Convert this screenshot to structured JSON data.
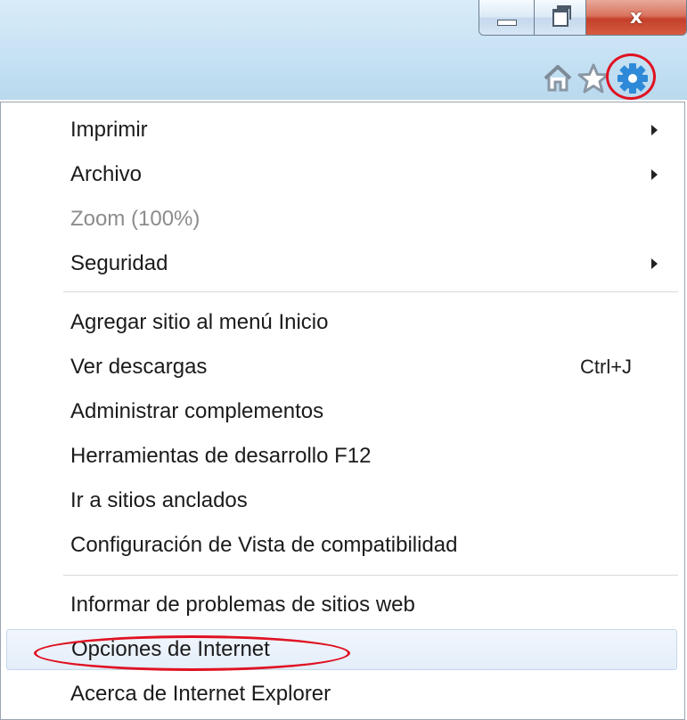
{
  "window": {
    "minimize_icon": "minimize-icon",
    "maximize_icon": "restore-icon",
    "close_glyph": "x"
  },
  "toolbar": {
    "icons": [
      "home-icon",
      "favorites-star-icon",
      "tools-gear-icon"
    ],
    "accent": "#2e8ad8",
    "annotation_color": "#e01222"
  },
  "menu": {
    "items": [
      {
        "label": "Imprimir",
        "submenu": true
      },
      {
        "label": "Archivo",
        "submenu": true
      },
      {
        "label": "Zoom (100%)",
        "disabled": true
      },
      {
        "label": "Seguridad",
        "submenu": true
      },
      {
        "label": "Agregar sitio al menú Inicio"
      },
      {
        "label": "Ver descargas",
        "shortcut": "Ctrl+J"
      },
      {
        "label": "Administrar complementos"
      },
      {
        "label": "Herramientas de desarrollo F12"
      },
      {
        "label": "Ir a sitios anclados"
      },
      {
        "label": "Configuración de Vista de compatibilidad"
      },
      {
        "label": "Informar de problemas de sitios web"
      },
      {
        "label": "Opciones de Internet",
        "highlighted": true
      },
      {
        "label": "Acerca de Internet Explorer"
      }
    ]
  }
}
